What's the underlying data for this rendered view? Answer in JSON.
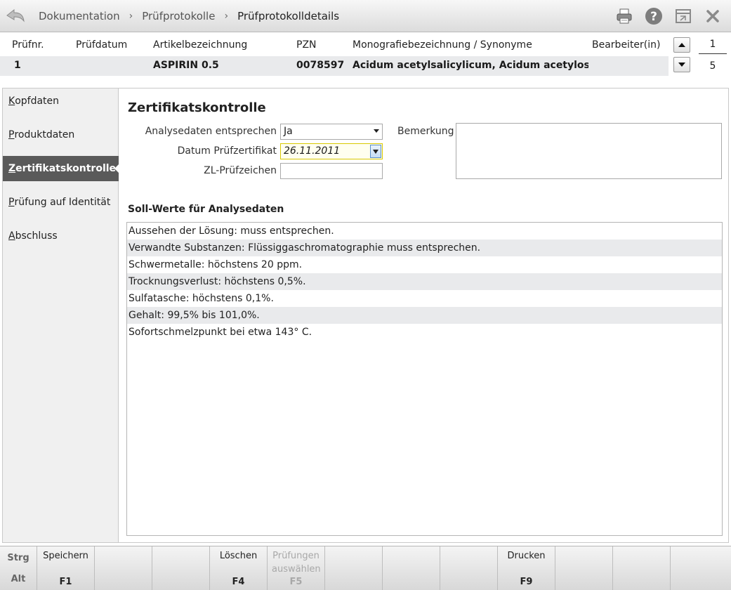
{
  "breadcrumb": {
    "items": [
      "Dokumentation",
      "Prüfprotokolle",
      "Prüfprotokolldetails"
    ],
    "separator": "›"
  },
  "toolbar_icons": [
    "printer-icon",
    "help-icon",
    "window-icon",
    "close-icon"
  ],
  "header": {
    "columns": [
      "Prüfnr.",
      "Prüfdatum",
      "Artikelbezeichnung",
      "PZN",
      "Monografiebezeichnung / Synonyme",
      "Bearbeiter(in)"
    ],
    "row": {
      "pruefnr": "1",
      "pruefdatum": "",
      "artikel": "ASPIRIN 0.5",
      "pzn": "0078597",
      "monografie": "Acidum acetylsalicylicum, Acidum acetylosalicyli",
      "bearbeiter": ""
    },
    "pager": {
      "current": "1",
      "total": "5"
    }
  },
  "sidebar": {
    "items": [
      {
        "label": "Kopfdaten",
        "accel": "K",
        "rest": "opfdaten"
      },
      {
        "label": "Produktdaten",
        "accel": "P",
        "rest": "roduktdaten"
      },
      {
        "label": "Zertifikatskontrolle",
        "accel": "Z",
        "rest": "ertifikatskontrolle"
      },
      {
        "label": "Prüfung auf Identität",
        "accel": "P",
        "rest": "rüfung auf Identität"
      },
      {
        "label": "Abschluss",
        "accel": "A",
        "rest": "bschluss"
      }
    ],
    "active_index": 2
  },
  "form": {
    "title": "Zertifikatskontrolle",
    "analysedaten_label": "Analysedaten entsprechen",
    "analysedaten_value": "Ja",
    "datum_label": "Datum Prüfzertifikat",
    "datum_value": "26.11.2011",
    "zl_label": "ZL-Prüfzeichen",
    "zl_value": "",
    "bemerkung_label": "Bemerkung",
    "bemerkung_value": ""
  },
  "soll": {
    "title": "Soll-Werte für Analysedaten",
    "rows": [
      "Aussehen der Lösung: muss entsprechen.",
      "Verwandte Substanzen: Flüssiggaschromatographie muss entsprechen.",
      "Schwermetalle: höchstens 20 ppm.",
      "Trocknungsverlust: höchstens 0,5%.",
      "Sulfatasche: höchstens 0,1%.",
      "Gehalt: 99,5% bis 101,0%.",
      "Sofortschmelzpunkt bei etwa 143° C."
    ]
  },
  "fkeys": {
    "mod_top": "Strg",
    "mod_bottom": "Alt",
    "keys": [
      {
        "label": "Speichern",
        "key": "F1",
        "enabled": true
      },
      {
        "label": "",
        "key": "",
        "enabled": true
      },
      {
        "label": "",
        "key": "",
        "enabled": true
      },
      {
        "label": "Löschen",
        "key": "F4",
        "enabled": true
      },
      {
        "label": "Prüfungen auswählen",
        "key": "F5",
        "enabled": false
      },
      {
        "label": "",
        "key": "",
        "enabled": true
      },
      {
        "label": "",
        "key": "",
        "enabled": true
      },
      {
        "label": "",
        "key": "",
        "enabled": true
      },
      {
        "label": "Drucken",
        "key": "F9",
        "enabled": true
      },
      {
        "label": "",
        "key": "",
        "enabled": true
      },
      {
        "label": "",
        "key": "",
        "enabled": true
      },
      {
        "label": "",
        "key": "",
        "enabled": true
      }
    ]
  }
}
